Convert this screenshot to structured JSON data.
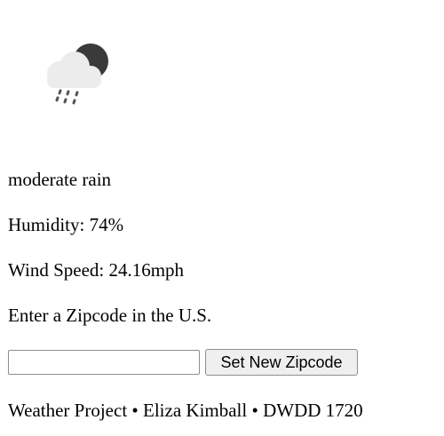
{
  "weather": {
    "icon": "cloud-moon-rain-icon",
    "description": "moderate rain",
    "humidity": "Humidity: 74%",
    "wind_speed": "Wind Speed: 24.16mph"
  },
  "zip_form": {
    "prompt": "Enter a Zipcode in the U.S.",
    "input_value": "",
    "input_placeholder": "",
    "button_label": "Set New Zipcode"
  },
  "footer": {
    "text": "Weather Project • Eliza Kimball • DWDD 1720"
  },
  "colors": {
    "moon": "#3a3a3a",
    "cloud": "#ececec",
    "rain": "#555555"
  }
}
